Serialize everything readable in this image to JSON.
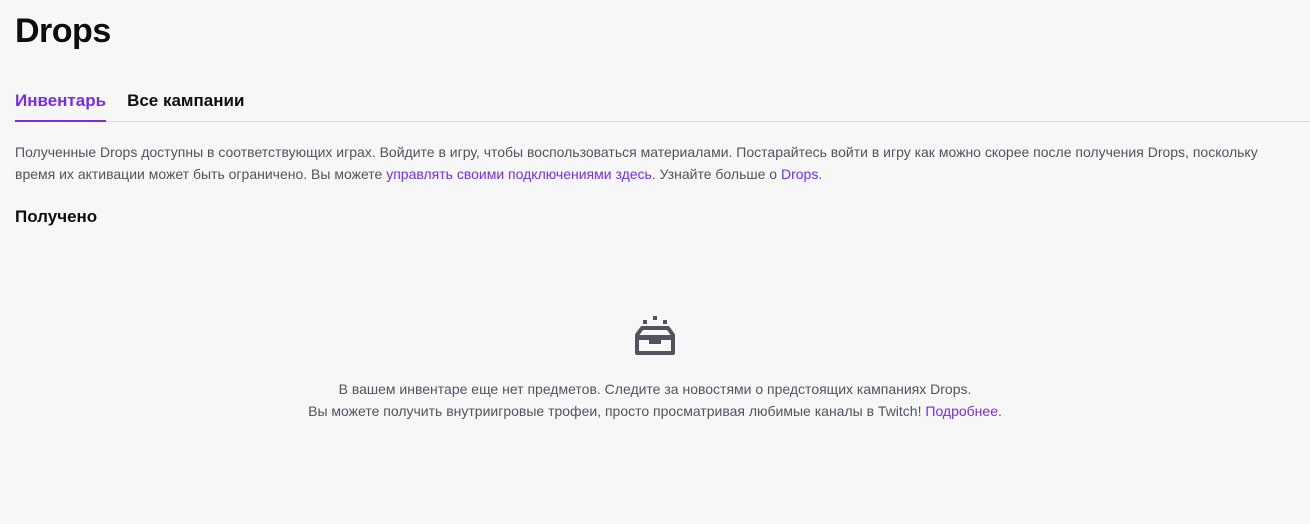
{
  "page": {
    "title": "Drops"
  },
  "tabs": [
    {
      "label": "Инвентарь",
      "active": true
    },
    {
      "label": "Все кампании",
      "active": false
    }
  ],
  "description": {
    "text_before_link": "Полученные Drops доступны в соответствующих играх. Войдите в игру, чтобы воспользоваться материалами. Постарайтесь войти в игру как можно скорее после получения Drops, поскольку время их активации может быть ограничено. Вы можете ",
    "manage_link": "управлять своими подключениями здесь",
    "text_middle": ". Узнайте больше о ",
    "drops_link": "Drops",
    "text_after": "."
  },
  "section": {
    "title": "Получено"
  },
  "empty_state": {
    "icon": "inventory-box-icon",
    "line1": "В вашем инвентаре еще нет предметов. Следите за новостями о предстоящих кампаниях Drops.",
    "line2_text": "Вы можете получить внутриигровые трофеи, просто просматривая любимые каналы в Twitch! ",
    "learn_more_link": "Подробнее",
    "line2_end": "."
  },
  "colors": {
    "accent": "#772ce8",
    "background": "#f7f7f8",
    "text_muted": "#53535f"
  }
}
